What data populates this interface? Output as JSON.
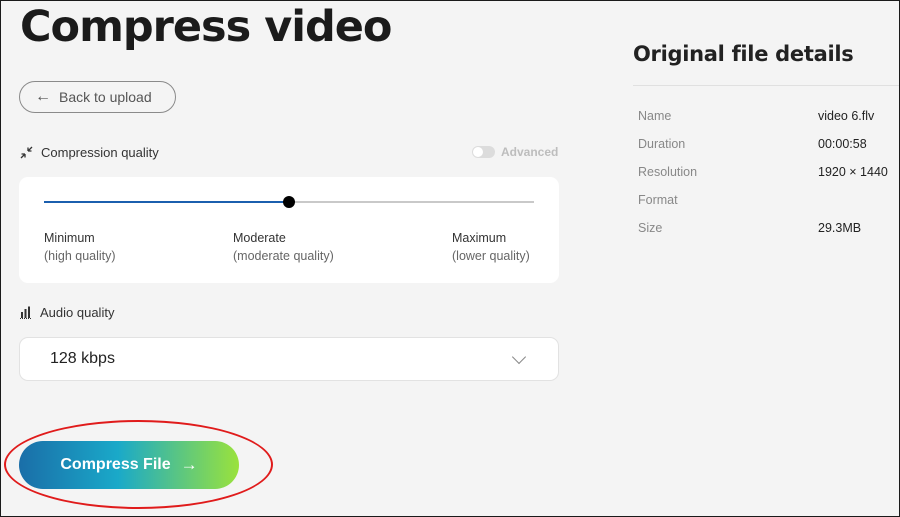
{
  "page": {
    "title": "Compress video"
  },
  "back_button": {
    "label": "Back to upload"
  },
  "compression": {
    "label": "Compression quality",
    "advanced_label": "Advanced",
    "slider_value_fraction": 0.5,
    "levels": [
      {
        "name": "Minimum",
        "desc": "(high quality)"
      },
      {
        "name": "Moderate",
        "desc": "(moderate quality)"
      },
      {
        "name": "Maximum",
        "desc": "(lower quality)"
      }
    ]
  },
  "audio": {
    "label": "Audio quality",
    "selected": "128 kbps"
  },
  "compress_button": {
    "label": "Compress File"
  },
  "details": {
    "title": "Original file details",
    "rows": [
      {
        "key": "Name",
        "value": "video 6.flv"
      },
      {
        "key": "Duration",
        "value": "00:00:58"
      },
      {
        "key": "Resolution",
        "value": "1920 × 1440"
      },
      {
        "key": "Format",
        "value": ""
      },
      {
        "key": "Size",
        "value": "29.3MB"
      }
    ]
  },
  "colors": {
    "slider_fill": "#1b5fae",
    "highlight": "#e01b1b"
  }
}
